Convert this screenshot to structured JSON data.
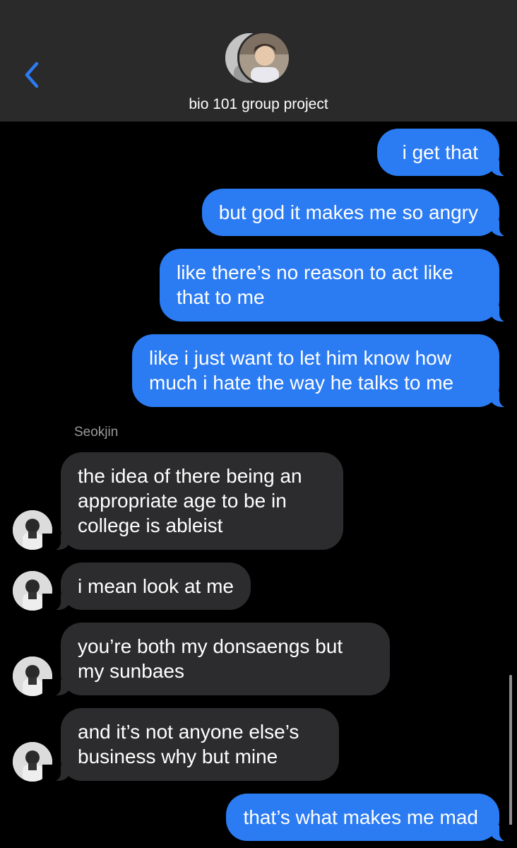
{
  "header": {
    "back_icon": "chevron-left-icon",
    "title": "bio 101 group project",
    "accent": "#2b7bf3"
  },
  "conversation": {
    "sender_name": "Seokjin",
    "messages": [
      {
        "from": "me",
        "text": "i get that"
      },
      {
        "from": "me",
        "text": "but god it makes me so angry"
      },
      {
        "from": "me",
        "text": "like there’s no reason to act like\nthat to me"
      },
      {
        "from": "me",
        "text": "like i just want to let him know how\nmuch i hate the way he talks to me"
      },
      {
        "from": "Seokjin",
        "text": "the idea of there being an\nappropriate age to be in\ncollege is ableist"
      },
      {
        "from": "Seokjin",
        "text": "i mean look at me"
      },
      {
        "from": "Seokjin",
        "text": "you’re both my donsaengs but\nmy sunbaes"
      },
      {
        "from": "Seokjin",
        "text": "and it’s not anyone else’s\nbusiness why but mine"
      },
      {
        "from": "me",
        "text": "that’s what makes me mad"
      }
    ]
  },
  "colors": {
    "outgoing_bubble": "#2b7bf3",
    "incoming_bubble": "#2c2c2e",
    "background": "#000000",
    "header_bg": "#2a2a2a"
  }
}
